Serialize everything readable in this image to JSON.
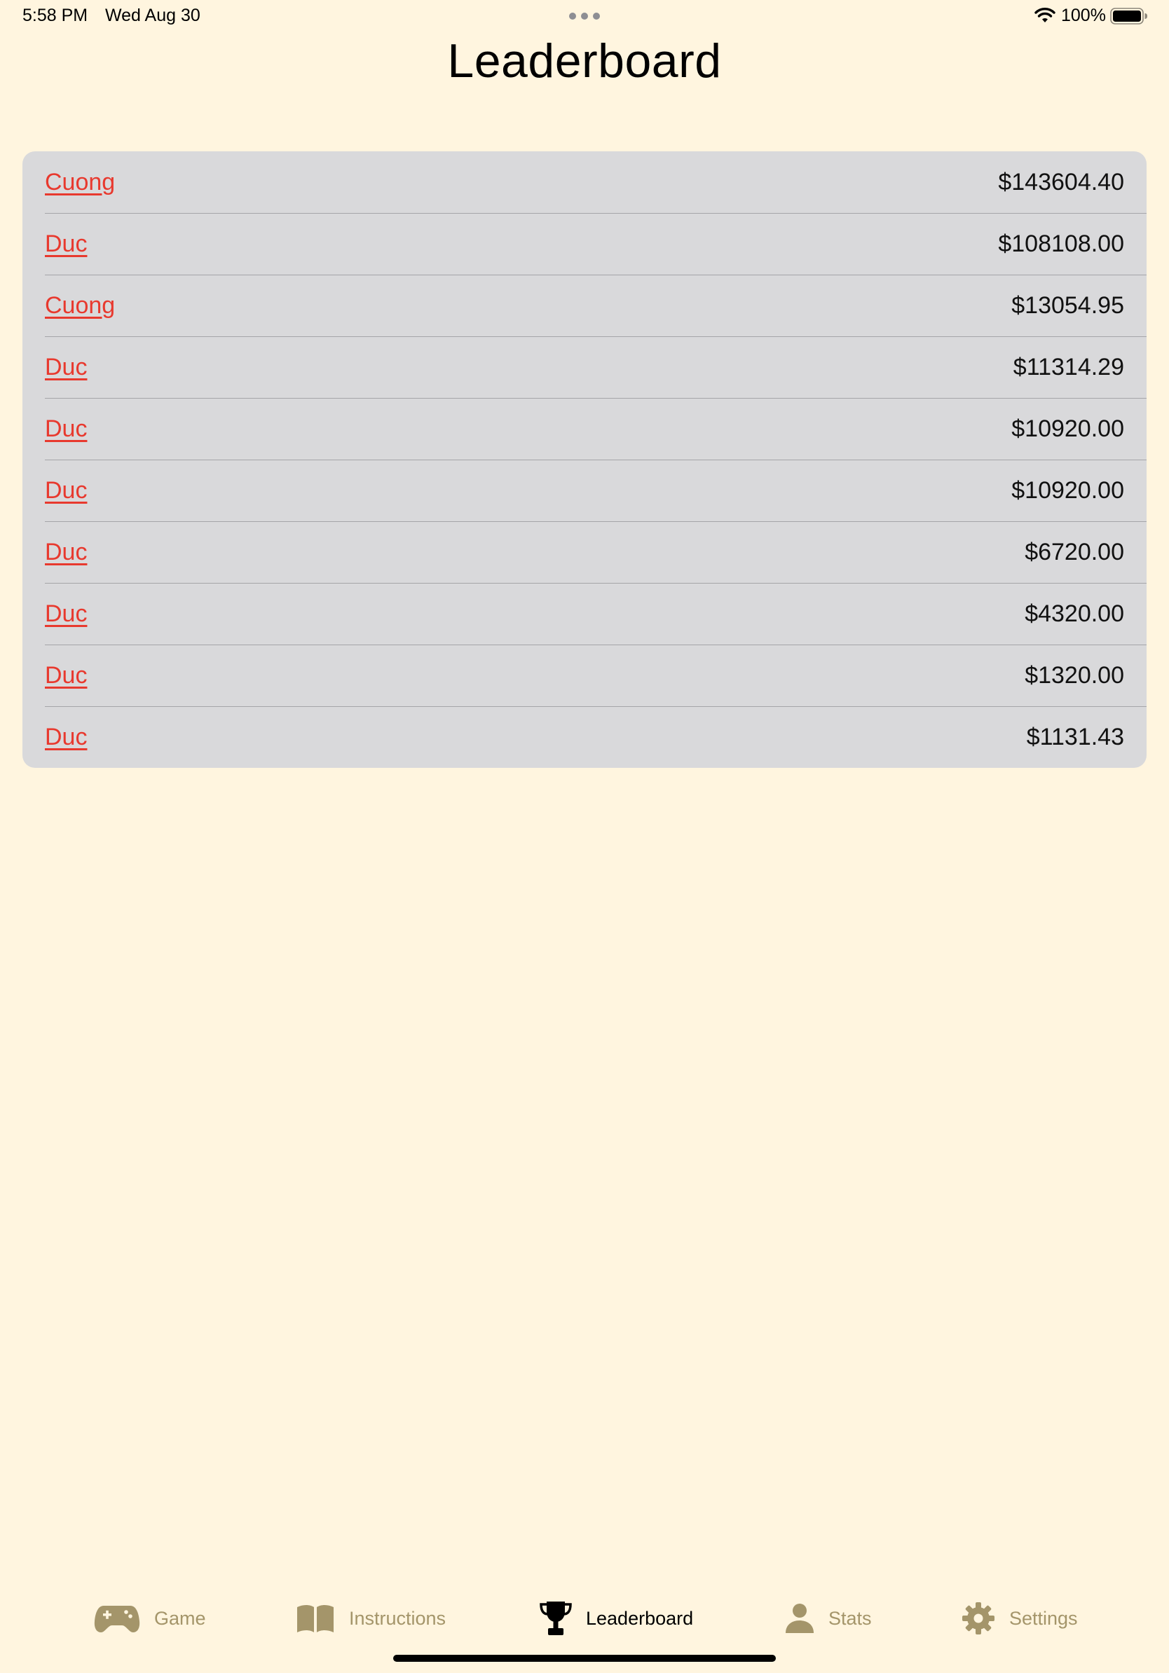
{
  "status_bar": {
    "time": "5:58 PM",
    "date": "Wed Aug 30",
    "battery_percent": "100%",
    "wifi_icon": "wifi-icon",
    "battery_icon": "battery-full-icon"
  },
  "page": {
    "title": "Leaderboard"
  },
  "leaderboard": {
    "rows": [
      {
        "name": "Cuong",
        "score": "$143604.40"
      },
      {
        "name": "Duc",
        "score": "$108108.00"
      },
      {
        "name": "Cuong",
        "score": "$13054.95"
      },
      {
        "name": "Duc",
        "score": "$11314.29"
      },
      {
        "name": "Duc",
        "score": "$10920.00"
      },
      {
        "name": "Duc",
        "score": "$10920.00"
      },
      {
        "name": "Duc",
        "score": "$6720.00"
      },
      {
        "name": "Duc",
        "score": "$4320.00"
      },
      {
        "name": "Duc",
        "score": "$1320.00"
      },
      {
        "name": "Duc",
        "score": "$1131.43"
      }
    ]
  },
  "tab_bar": {
    "tabs": [
      {
        "label": "Game",
        "icon": "gamecontroller-icon",
        "active": false
      },
      {
        "label": "Instructions",
        "icon": "book-icon",
        "active": false
      },
      {
        "label": "Leaderboard",
        "icon": "trophy-icon",
        "active": true
      },
      {
        "label": "Stats",
        "icon": "person-icon",
        "active": false
      },
      {
        "label": "Settings",
        "icon": "gear-icon",
        "active": false
      }
    ]
  },
  "colors": {
    "background": "#FFF5DF",
    "card": "#D9D9DB",
    "name_link": "#E8392E",
    "tab_inactive": "#A4956A",
    "tab_active": "#000000"
  }
}
